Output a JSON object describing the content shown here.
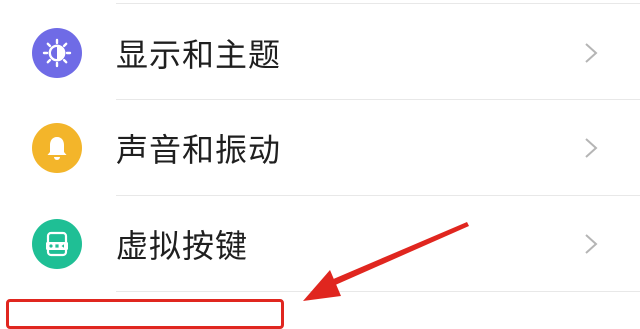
{
  "settings": {
    "items": [
      {
        "label": "显示和主题",
        "icon": "brightness-icon",
        "icon_color": "#6f6be6"
      },
      {
        "label": "声音和振动",
        "icon": "bell-icon",
        "icon_color": "#f3b52a"
      },
      {
        "label": "虚拟按键",
        "icon": "virtual-keys-icon",
        "icon_color": "#1fbf95"
      }
    ]
  },
  "annotation": {
    "highlight_color": "#e0261f"
  }
}
